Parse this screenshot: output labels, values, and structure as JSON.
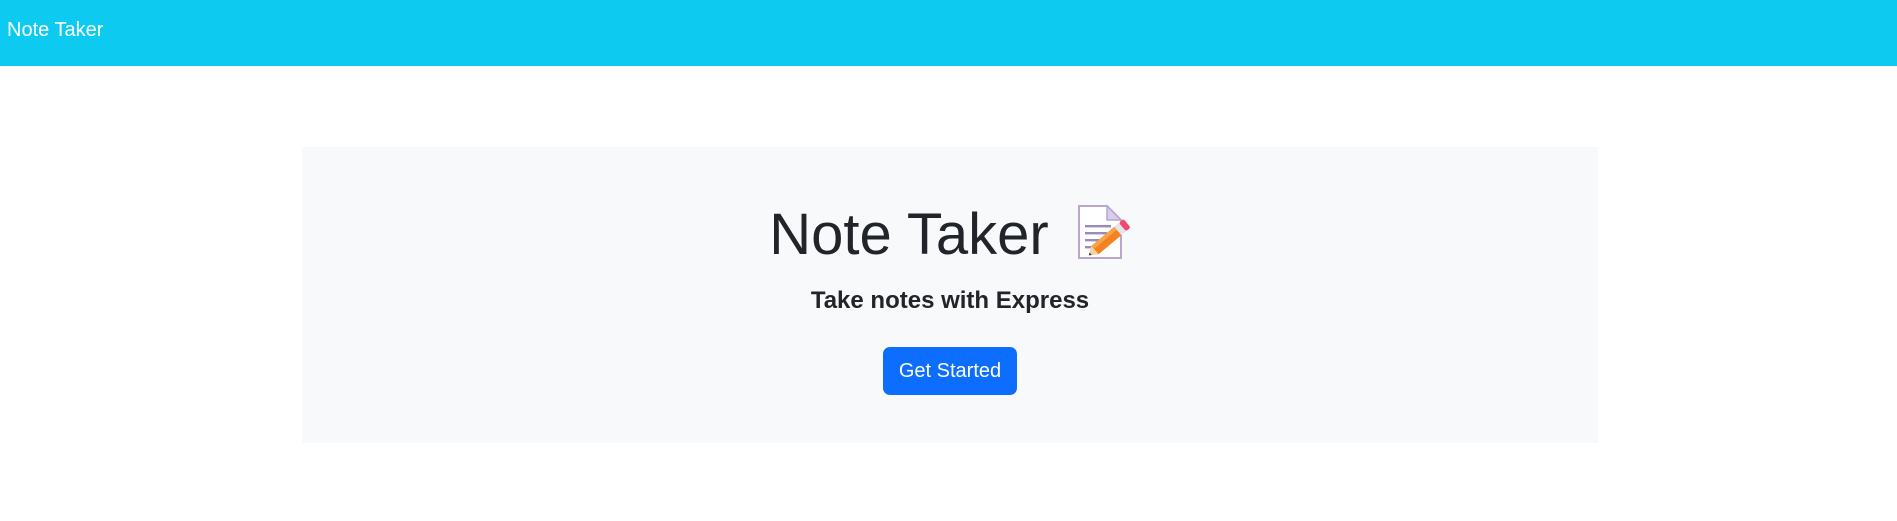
{
  "navbar": {
    "brand": "Note Taker",
    "background_color": "#0dcaf0"
  },
  "hero": {
    "title": "Note Taker",
    "icon": "memo-pencil-icon",
    "subtitle": "Take notes with Express",
    "button_label": "Get Started",
    "button_color": "#0d6efd",
    "background_color": "#f8f9fa"
  }
}
